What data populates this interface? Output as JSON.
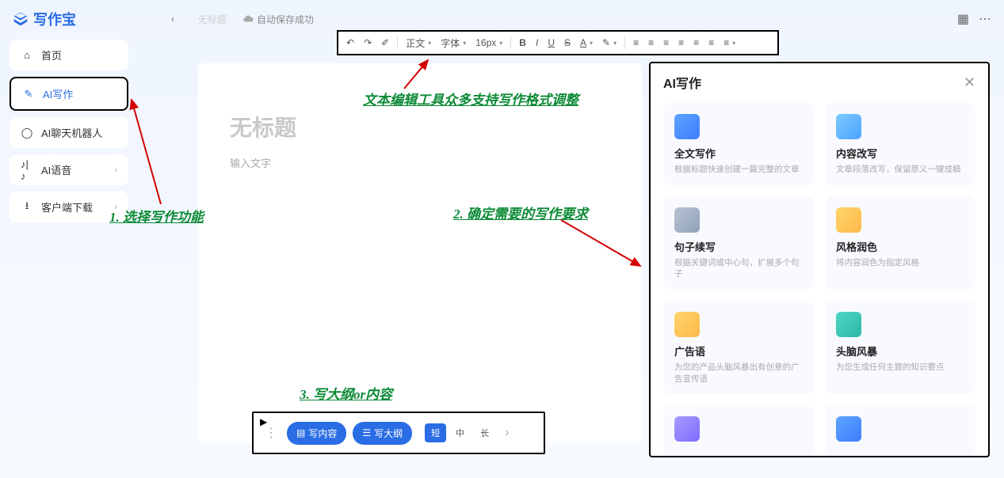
{
  "header": {
    "app_name": "写作宝",
    "tab_untitled": "无标题",
    "autosave": "自动保存成功"
  },
  "sidebar": {
    "items": [
      {
        "label": "首页"
      },
      {
        "label": "AI写作"
      },
      {
        "label": "AI聊天机器人"
      },
      {
        "label": "AI语音"
      },
      {
        "label": "客户端下载"
      }
    ]
  },
  "toolbar": {
    "align": "正文",
    "font": "字体",
    "size": "16px"
  },
  "editor": {
    "title_placeholder": "无标题",
    "body_placeholder": "输入文字"
  },
  "ai_panel": {
    "title": "AI写作",
    "cards": [
      {
        "title": "全文写作",
        "desc": "根据标题快速创建一篇完整的文章"
      },
      {
        "title": "内容改写",
        "desc": "文章段落改写，保留原义一键成稿"
      },
      {
        "title": "句子续写",
        "desc": "根据关键词或中心句，扩展多个句子"
      },
      {
        "title": "风格润色",
        "desc": "将内容润色为指定风格"
      },
      {
        "title": "广告语",
        "desc": "为您的产品头脑风暴出有创意的广告宣传语"
      },
      {
        "title": "头脑风暴",
        "desc": "为您生成任何主题的知识要点"
      }
    ]
  },
  "actionbar": {
    "write_content": "写内容",
    "write_outline": "写大纲",
    "len_short": "短",
    "len_mid": "中",
    "len_long": "长"
  },
  "annotations": {
    "a1": "1. 选择写作功能",
    "a2": "2. 确定需要的写作要求",
    "a3": "3. 写大纲or内容",
    "a_toolbar": "文本编辑工具众多支持写作格式调整"
  }
}
